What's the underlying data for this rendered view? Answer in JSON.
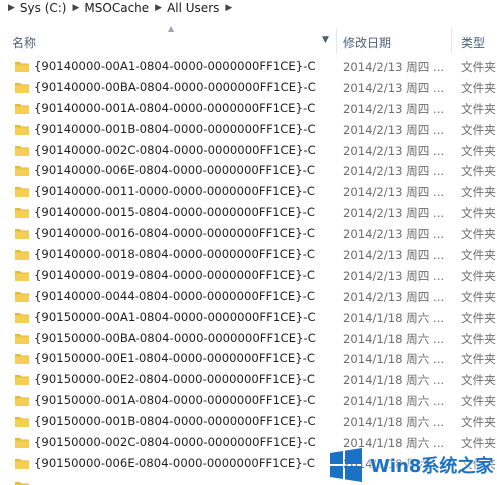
{
  "breadcrumb": [
    "Sys (C:)",
    "MSOCache",
    "All Users"
  ],
  "header": {
    "name": "名称",
    "date": "修改日期",
    "type": "类型"
  },
  "files": [
    {
      "name": "{90140000-00A1-0804-0000-0000000FF1CE}-C",
      "date": "2014/2/13 周四 ...",
      "type": "文件夹"
    },
    {
      "name": "{90140000-00BA-0804-0000-0000000FF1CE}-C",
      "date": "2014/2/13 周四 ...",
      "type": "文件夹"
    },
    {
      "name": "{90140000-001A-0804-0000-0000000FF1CE}-C",
      "date": "2014/2/13 周四 ...",
      "type": "文件夹"
    },
    {
      "name": "{90140000-001B-0804-0000-0000000FF1CE}-C",
      "date": "2014/2/13 周四 ...",
      "type": "文件夹"
    },
    {
      "name": "{90140000-002C-0804-0000-0000000FF1CE}-C",
      "date": "2014/2/13 周四 ...",
      "type": "文件夹"
    },
    {
      "name": "{90140000-006E-0804-0000-0000000FF1CE}-C",
      "date": "2014/2/13 周四 ...",
      "type": "文件夹"
    },
    {
      "name": "{90140000-0011-0000-0000-0000000FF1CE}-C",
      "date": "2014/2/13 周四 ...",
      "type": "文件夹"
    },
    {
      "name": "{90140000-0015-0804-0000-0000000FF1CE}-C",
      "date": "2014/2/13 周四 ...",
      "type": "文件夹"
    },
    {
      "name": "{90140000-0016-0804-0000-0000000FF1CE}-C",
      "date": "2014/2/13 周四 ...",
      "type": "文件夹"
    },
    {
      "name": "{90140000-0018-0804-0000-0000000FF1CE}-C",
      "date": "2014/2/13 周四 ...",
      "type": "文件夹"
    },
    {
      "name": "{90140000-0019-0804-0000-0000000FF1CE}-C",
      "date": "2014/2/13 周四 ...",
      "type": "文件夹"
    },
    {
      "name": "{90140000-0044-0804-0000-0000000FF1CE}-C",
      "date": "2014/2/13 周四 ...",
      "type": "文件夹"
    },
    {
      "name": "{90150000-00A1-0804-0000-0000000FF1CE}-C",
      "date": "2014/1/18 周六 ...",
      "type": "文件夹"
    },
    {
      "name": "{90150000-00BA-0804-0000-0000000FF1CE}-C",
      "date": "2014/1/18 周六 ...",
      "type": "文件夹"
    },
    {
      "name": "{90150000-00E1-0804-0000-0000000FF1CE}-C",
      "date": "2014/1/18 周六 ...",
      "type": "文件夹"
    },
    {
      "name": "{90150000-00E2-0804-0000-0000000FF1CE}-C",
      "date": "2014/1/18 周六 ...",
      "type": "文件夹"
    },
    {
      "name": "{90150000-001A-0804-0000-0000000FF1CE}-C",
      "date": "2014/1/18 周六 ...",
      "type": "文件夹"
    },
    {
      "name": "{90150000-001B-0804-0000-0000000FF1CE}-C",
      "date": "2014/1/18 周六 ...",
      "type": "文件夹"
    },
    {
      "name": "{90150000-002C-0804-0000-0000000FF1CE}-C",
      "date": "2014/1/18 周六 ...",
      "type": "文件夹"
    },
    {
      "name": "{90150000-006E-0804-0000-0000000FF1CE}-C",
      "date": "2014/1/18 周六 ...",
      "type": "文件夹"
    }
  ],
  "watermark": {
    "text": "Win8系统之家"
  },
  "colors": {
    "header_text": "#4c607a",
    "secondary_text": "#6d6d6d",
    "folder_yellow": "#f5cf52",
    "watermark_blue": "#1b72c4"
  },
  "icons": {
    "folder": "folder-icon",
    "breadcrumb_separator": "chevron-right-icon",
    "sort": "sort-arrow-icon",
    "column_dropdown": "chevron-down-icon",
    "watermark_logo": "windows-logo-icon"
  }
}
